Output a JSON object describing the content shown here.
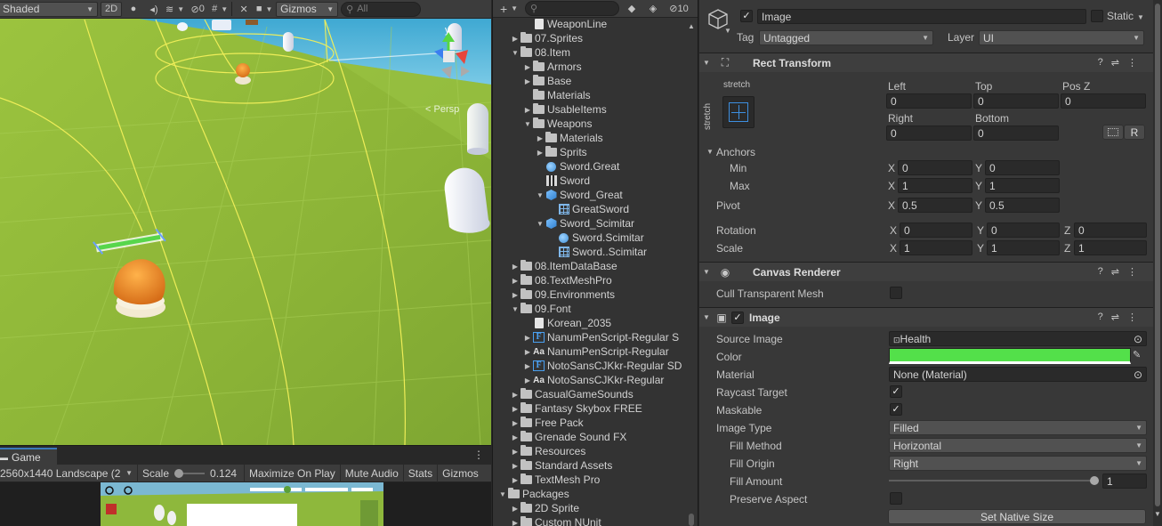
{
  "scene": {
    "shading_mode": "Shaded",
    "mode_2d": "2D",
    "hidden_count": "0",
    "gizmos_label": "Gizmos",
    "search_placeholder": "All",
    "persp_label": "Persp",
    "axis_y": "y"
  },
  "game": {
    "tab_label": "Game",
    "resolution": "2560x1440 Landscape (2",
    "scale_label": "Scale",
    "scale_value": "0.124",
    "scale_fraction": 0.0,
    "maximize_label": "Maximize On Play",
    "mute_label": "Mute Audio",
    "stats_label": "Stats",
    "gizmos_label": "Gizmos"
  },
  "project": {
    "hidden_count": "10",
    "rows": [
      {
        "label": "WeaponLine",
        "arrow": "",
        "icon": "file-icon",
        "indent": 2
      },
      {
        "label": "07.Sprites",
        "arrow": "▶",
        "icon": "folder-icon",
        "indent": 1
      },
      {
        "label": "08.Item",
        "arrow": "▼",
        "icon": "folder-icon",
        "indent": 1
      },
      {
        "label": "Armors",
        "arrow": "▶",
        "icon": "folder-icon",
        "indent": 2
      },
      {
        "label": "Base",
        "arrow": "▶",
        "icon": "folder-icon",
        "indent": 2
      },
      {
        "label": "Materials",
        "arrow": "",
        "icon": "folder-icon",
        "indent": 2
      },
      {
        "label": "UsableItems",
        "arrow": "▶",
        "icon": "folder-icon",
        "indent": 2
      },
      {
        "label": "Weapons",
        "arrow": "▼",
        "icon": "folder-icon",
        "indent": 2
      },
      {
        "label": "Materials",
        "arrow": "▶",
        "icon": "folder-icon",
        "indent": 3
      },
      {
        "label": "Sprits",
        "arrow": "▶",
        "icon": "folder-icon",
        "indent": 3
      },
      {
        "label": "Sword.Great",
        "arrow": "",
        "icon": "sprite-icon",
        "indent": 3
      },
      {
        "label": "Sword",
        "arrow": "",
        "icon": "sword-texture-icon",
        "indent": 3
      },
      {
        "label": "Sword_Great",
        "arrow": "▼",
        "icon": "prefab-icon",
        "indent": 3
      },
      {
        "label": "GreatSword",
        "arrow": "",
        "icon": "mesh-icon",
        "indent": 4
      },
      {
        "label": "Sword_Scimitar",
        "arrow": "▼",
        "icon": "prefab-icon",
        "indent": 3
      },
      {
        "label": "Sword.Scimitar",
        "arrow": "",
        "icon": "sprite-icon",
        "indent": 4
      },
      {
        "label": "Sword..Scimitar",
        "arrow": "",
        "icon": "mesh-icon",
        "indent": 4
      },
      {
        "label": "08.ItemDataBase",
        "arrow": "▶",
        "icon": "folder-icon",
        "indent": 1
      },
      {
        "label": "08.TextMeshPro",
        "arrow": "▶",
        "icon": "folder-icon",
        "indent": 1
      },
      {
        "label": "09.Environments",
        "arrow": "▶",
        "icon": "folder-icon",
        "indent": 1
      },
      {
        "label": "09.Font",
        "arrow": "▼",
        "icon": "folder-icon",
        "indent": 1
      },
      {
        "label": "Korean_2035",
        "arrow": "",
        "icon": "file-icon",
        "indent": 2
      },
      {
        "label": "NanumPenScript-Regular S",
        "arrow": "▶",
        "icon": "font-asset-icon",
        "indent": 2
      },
      {
        "label": "NanumPenScript-Regular",
        "arrow": "▶",
        "icon": "font-icon",
        "indent": 2
      },
      {
        "label": "NotoSansCJKkr-Regular SD",
        "arrow": "▶",
        "icon": "font-asset-icon",
        "indent": 2
      },
      {
        "label": "NotoSansCJKkr-Regular",
        "arrow": "▶",
        "icon": "font-icon",
        "indent": 2
      },
      {
        "label": "CasualGameSounds",
        "arrow": "▶",
        "icon": "folder-icon",
        "indent": 1
      },
      {
        "label": "Fantasy Skybox FREE",
        "arrow": "▶",
        "icon": "folder-icon",
        "indent": 1
      },
      {
        "label": "Free Pack",
        "arrow": "▶",
        "icon": "folder-icon",
        "indent": 1
      },
      {
        "label": "Grenade Sound FX",
        "arrow": "▶",
        "icon": "folder-icon",
        "indent": 1
      },
      {
        "label": "Resources",
        "arrow": "▶",
        "icon": "folder-icon",
        "indent": 1
      },
      {
        "label": "Standard Assets",
        "arrow": "▶",
        "icon": "folder-icon",
        "indent": 1
      },
      {
        "label": "TextMesh Pro",
        "arrow": "▶",
        "icon": "folder-icon",
        "indent": 1
      },
      {
        "label": "Packages",
        "arrow": "▼",
        "icon": "folder-icon",
        "indent": 0
      },
      {
        "label": "2D Sprite",
        "arrow": "▶",
        "icon": "folder-icon",
        "indent": 1
      },
      {
        "label": "Custom NUnit",
        "arrow": "▶",
        "icon": "folder-icon",
        "indent": 1
      }
    ]
  },
  "inspector": {
    "object_name": "Image",
    "static_label": "Static",
    "tag_label": "Tag",
    "tag_value": "Untagged",
    "layer_label": "Layer",
    "layer_value": "UI",
    "rect": {
      "title": "Rect Transform",
      "stretch_top": "stretch",
      "stretch_side": "stretch",
      "left_label": "Left",
      "left_value": "0",
      "top_label": "Top",
      "top_value": "0",
      "posz_label": "Pos Z",
      "posz_value": "0",
      "right_label": "Right",
      "right_value": "0",
      "bottom_label": "Bottom",
      "bottom_value": "0",
      "r_button": "R",
      "anchors_label": "Anchors",
      "min_label": "Min",
      "min_x": "0",
      "min_y": "0",
      "max_label": "Max",
      "max_x": "1",
      "max_y": "1",
      "pivot_label": "Pivot",
      "pivot_x": "0.5",
      "pivot_y": "0.5",
      "rotation_label": "Rotation",
      "rot_x": "0",
      "rot_y": "0",
      "rot_z": "0",
      "scale_label": "Scale",
      "scale_x": "1",
      "scale_y": "1",
      "scale_z": "1",
      "x": "X",
      "y": "Y",
      "z": "Z"
    },
    "canvas_renderer": {
      "title": "Canvas Renderer",
      "cull_label": "Cull Transparent Mesh"
    },
    "image": {
      "title": "Image",
      "source_label": "Source Image",
      "source_value": "Health",
      "color_label": "Color",
      "color_value": "#53e04a",
      "material_label": "Material",
      "material_value": "None (Material)",
      "raycast_label": "Raycast Target",
      "maskable_label": "Maskable",
      "image_type_label": "Image Type",
      "image_type_value": "Filled",
      "fill_method_label": "Fill Method",
      "fill_method_value": "Horizontal",
      "fill_origin_label": "Fill Origin",
      "fill_origin_value": "Right",
      "fill_amount_label": "Fill Amount",
      "fill_amount_value": "1",
      "preserve_label": "Preserve Aspect",
      "native_size_button": "Set Native Size"
    }
  },
  "colors": {
    "accent": "#3a79bb",
    "grass": "#8fb83a",
    "sky": "#4fb3d8",
    "gizmo_yellow": "#f0f04a"
  }
}
